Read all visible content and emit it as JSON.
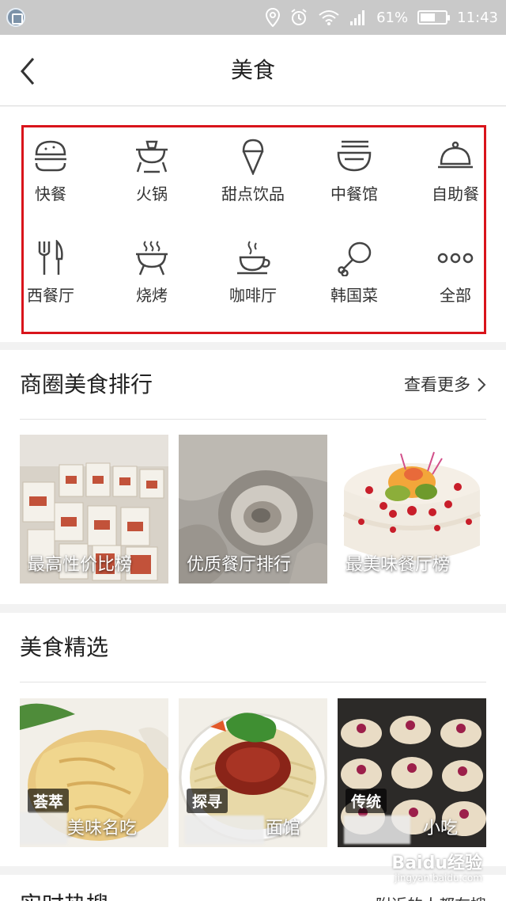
{
  "status_bar": {
    "battery": "61%",
    "time": "11:43",
    "battery_level": 0.61
  },
  "header": {
    "title": "美食"
  },
  "categories": [
    {
      "label": "快餐",
      "icon": "burger-icon"
    },
    {
      "label": "火锅",
      "icon": "hotpot-icon"
    },
    {
      "label": "甜点饮品",
      "icon": "ice-cream-icon"
    },
    {
      "label": "中餐馆",
      "icon": "noodle-bowl-icon"
    },
    {
      "label": "自助餐",
      "icon": "cloche-icon"
    },
    {
      "label": "西餐厅",
      "icon": "fork-knife-icon"
    },
    {
      "label": "烧烤",
      "icon": "grill-icon"
    },
    {
      "label": "咖啡厅",
      "icon": "coffee-cup-icon"
    },
    {
      "label": "韩国菜",
      "icon": "drumstick-icon"
    },
    {
      "label": "全部",
      "icon": "more-dots-icon"
    }
  ],
  "ranking": {
    "title": "商圈美食排行",
    "more": "查看更多",
    "cards": [
      {
        "label": "最高性价比榜"
      },
      {
        "label": "优质餐厅排行"
      },
      {
        "label": "最美味餐厅榜"
      }
    ]
  },
  "featured": {
    "title": "美食精选",
    "cards": [
      {
        "badge": "荟萃",
        "label": "美味名吃"
      },
      {
        "badge": "探寻",
        "label": "面馆"
      },
      {
        "badge": "传统",
        "label": "小吃"
      }
    ]
  },
  "bottom": {
    "title": "实时热搜",
    "right_text": "附近的人都在搜"
  },
  "watermark": {
    "main": "Baidu经验",
    "sub": "jingyan.baidu.com"
  },
  "colors": {
    "highlight_frame": "#d9141b",
    "status_bar": "#c9c9c9"
  }
}
